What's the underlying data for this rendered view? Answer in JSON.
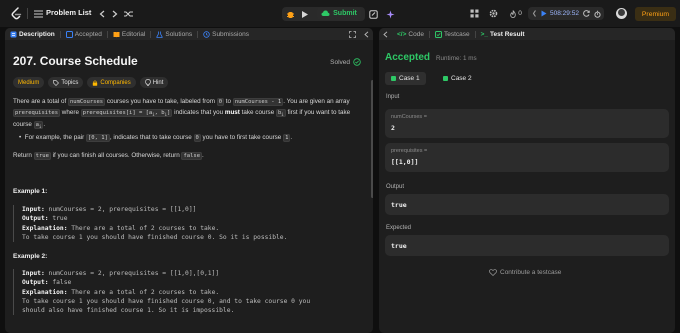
{
  "header": {
    "problem_list": "Problem List",
    "submit": "Submit",
    "timer": "508:29:52",
    "premium": "Premium",
    "streak": "0"
  },
  "left_tabs": [
    {
      "label": "Description"
    },
    {
      "label": "Accepted"
    },
    {
      "label": "Editorial"
    },
    {
      "label": "Solutions"
    },
    {
      "label": "Submissions"
    }
  ],
  "problem": {
    "title": "207. Course Schedule",
    "status": "Solved",
    "chips": {
      "difficulty": "Medium",
      "topics": "Topics",
      "companies": "Companies",
      "hint": "Hint"
    },
    "p1_a": "There are a total of ",
    "p1_code1": "numCourses",
    "p1_b": " courses you have to take, labeled from ",
    "p1_code2": "0",
    "p1_c": " to ",
    "p1_code3": "numCourses - 1",
    "p1_d": ". You are given an array ",
    "p1_code4": "prerequisites",
    "p1_e": " where ",
    "p1_code5": "prerequisites[i] = [a",
    "p1_code5_sub": "i",
    "p1_code5_b": ", b",
    "p1_code5_sub2": "i",
    "p1_code5_c": "]",
    "p1_f": " indicates that you ",
    "p1_bold": "must",
    "p1_g": " take course ",
    "p1_code6": "b",
    "p1_code6_sub": "i",
    "p1_h": " first if you want to take course ",
    "p1_code7": "a",
    "p1_code7_sub": "i",
    "p1_i": ".",
    "bullet_a": "For example, the pair ",
    "bullet_code1": "[0, 1]",
    "bullet_b": ", indicates that to take course ",
    "bullet_code2": "0",
    "bullet_c": " you have to first take course ",
    "bullet_code3": "1",
    "bullet_d": ".",
    "ret_a": "Return ",
    "ret_code1": "true",
    "ret_b": " if you can finish all courses. Otherwise, return ",
    "ret_code2": "false",
    "ret_c": "."
  },
  "examples": [
    {
      "label": "Example 1:",
      "input_label": "Input:",
      "input": "numCourses = 2, prerequisites = [[1,0]]",
      "output_label": "Output:",
      "output": "true",
      "expl_label": "Explanation:",
      "expl": "There are a total of 2 courses to take.",
      "expl2": "To take course 1 you should have finished course 0. So it is possible."
    },
    {
      "label": "Example 2:",
      "input_label": "Input:",
      "input": "numCourses = 2, prerequisites = [[1,0],[0,1]]",
      "output_label": "Output:",
      "output": "false",
      "expl_label": "Explanation:",
      "expl": "There are a total of 2 courses to take.",
      "expl2": "To take course 1 you should have finished course 0, and to take course 0 you",
      "expl3": "should also have finished course 1. So it is impossible."
    }
  ],
  "right_tabs": [
    {
      "label": "Code"
    },
    {
      "label": "Testcase"
    },
    {
      "label": "Test Result"
    }
  ],
  "result": {
    "status": "Accepted",
    "runtime": "Runtime: 1 ms",
    "case1": "Case 1",
    "case2": "Case 2",
    "input_label": "Input",
    "var1_name": "numCourses =",
    "var1_value": "2",
    "var2_name": "prerequisites =",
    "var2_value": "[[1,0]]",
    "output_label": "Output",
    "output_value": "true",
    "expected_label": "Expected",
    "expected_value": "true",
    "contribute": "Contribute a testcase"
  },
  "colors": {
    "accent_green": "#2ec866",
    "medium": "#ffb800",
    "premium": "#ffa116"
  }
}
